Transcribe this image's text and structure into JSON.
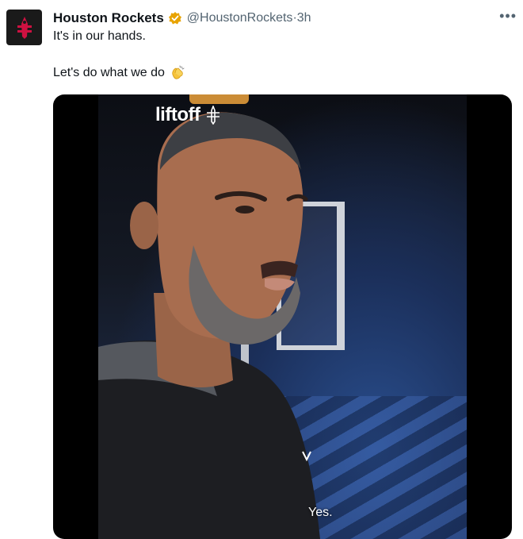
{
  "tweet": {
    "author_name": "Houston Rockets",
    "handle": "@HoustonRockets",
    "time_sep": " · ",
    "time": "3h",
    "line1": "It's in our hands.",
    "line2": "Let's do what we do",
    "more_icon": "•••"
  },
  "media": {
    "logo_text": "liftoff",
    "caption": "Yes."
  },
  "colors": {
    "verified": "#e8a300",
    "brand_red": "#ce1141",
    "text_primary": "#0f1419",
    "text_secondary": "#536471"
  },
  "icons": {
    "avatar": "rockets-logo-icon",
    "verified": "verified-badge-icon",
    "more": "more-options-icon",
    "clap": "clapping-hands-emoji",
    "logo_mark": "rockets-mark-icon"
  }
}
